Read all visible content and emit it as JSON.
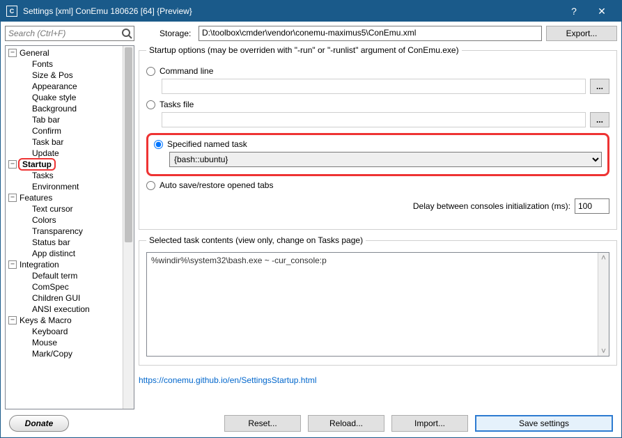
{
  "window": {
    "title": "Settings [xml] ConEmu 180626 [64] {Preview}",
    "help": "?",
    "close": "✕"
  },
  "search": {
    "placeholder": "Search (Ctrl+F)"
  },
  "storage": {
    "label": "Storage:",
    "path": "D:\\toolbox\\cmder\\vendor\\conemu-maximus5\\ConEmu.xml",
    "export": "Export..."
  },
  "tree": {
    "general": "General",
    "general_children": [
      "Fonts",
      "Size & Pos",
      "Appearance",
      "Quake style",
      "Background",
      "Tab bar",
      "Confirm",
      "Task bar",
      "Update"
    ],
    "startup": "Startup",
    "startup_children": [
      "Tasks",
      "Environment"
    ],
    "features": "Features",
    "features_children": [
      "Text cursor",
      "Colors",
      "Transparency",
      "Status bar",
      "App distinct"
    ],
    "integration": "Integration",
    "integration_children": [
      "Default term",
      "ComSpec",
      "Children GUI",
      "ANSI execution"
    ],
    "keys": "Keys & Macro",
    "keys_children": [
      "Keyboard",
      "Mouse",
      "Mark/Copy"
    ]
  },
  "startup_panel": {
    "group_title": "Startup options (may be overriden with \"-run\" or \"-runlist\" argument of ConEmu.exe)",
    "cmd_line": "Command line",
    "tasks_file": "Tasks file",
    "named_task": "Specified named task",
    "named_task_value": "{bash::ubuntu}",
    "auto_save": "Auto save/restore opened tabs",
    "dots": "...",
    "delay_label": "Delay between consoles initialization (ms):",
    "delay_value": "100",
    "contents_title": "Selected task contents (view only, change on Tasks page)",
    "contents_text": "%windir%\\system32\\bash.exe ~ -cur_console:p",
    "link": "https://conemu.github.io/en/SettingsStartup.html"
  },
  "footer": {
    "donate": "Donate",
    "reset": "Reset...",
    "reload": "Reload...",
    "import": "Import...",
    "save": "Save settings"
  }
}
